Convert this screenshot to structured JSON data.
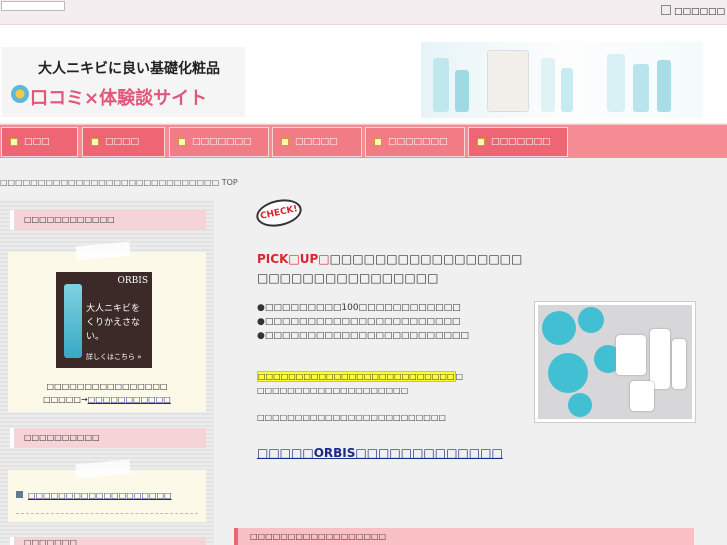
{
  "topbar": {
    "search_value": "",
    "bookmark_label": "□□□□□□"
  },
  "logo": {
    "line1": "大人ニキビに良い基礎化粧品",
    "line2": "口コミ×体験談サイト"
  },
  "nav": [
    {
      "label": "□□□"
    },
    {
      "label": "□□□□"
    },
    {
      "label": "□□□□□□□"
    },
    {
      "label": "□□□□□"
    },
    {
      "label": "□□□□□□□"
    },
    {
      "label": "□□□□□□□"
    }
  ],
  "breadcrumb": "□□□□□□□□□□□□□□□□□□□□□□□□□□□□□ TOP",
  "sidebar": {
    "box1_title": "□□□□□□□□□□□□",
    "ad": {
      "brand": "ORBIS",
      "copy1": "大人ニキビを",
      "copy2": "くりかえさない。",
      "more": "詳しくはこちら »"
    },
    "box1_text1": "□□□□□□□□□□□□□□□□",
    "box1_text2_prefix": "□□□□□→",
    "box1_link": "□□□□□□□□□□□",
    "box2_title": "□□□□□□□□□□",
    "box2_link": "□□□□□□□□□□□□□□□□□□□",
    "box3_title": "□□□□□□□"
  },
  "main": {
    "check_label": "CHECK!",
    "heading1_red": "PICK□UP□",
    "heading1_rest": "□□□□□□□□□□□□□□□□□",
    "heading2": "□□□□□□□□□□□□□□□□",
    "bullets": [
      "●□□□□□□□□□100□□□□□□□□□□□□",
      "●□□□□□□□□□□□□□□□□□□□□□□□",
      "●□□□□□□□□□□□□□□□□□□□□□□□□"
    ],
    "highlight": "□□□□□□□□□□□□□□□□□□□□□□□□□□",
    "highlight_after": "□",
    "text1": "□□□□□□□□□□□□□□□□□□□□",
    "text2": "□□□□□□□□□□□□□□□□□□□□□□□□□",
    "big_link": "□□□□□ORBIS□□□□□□□□□□□□□",
    "footer_heading": "□□□□□□□□□□□□□□□□□□"
  }
}
